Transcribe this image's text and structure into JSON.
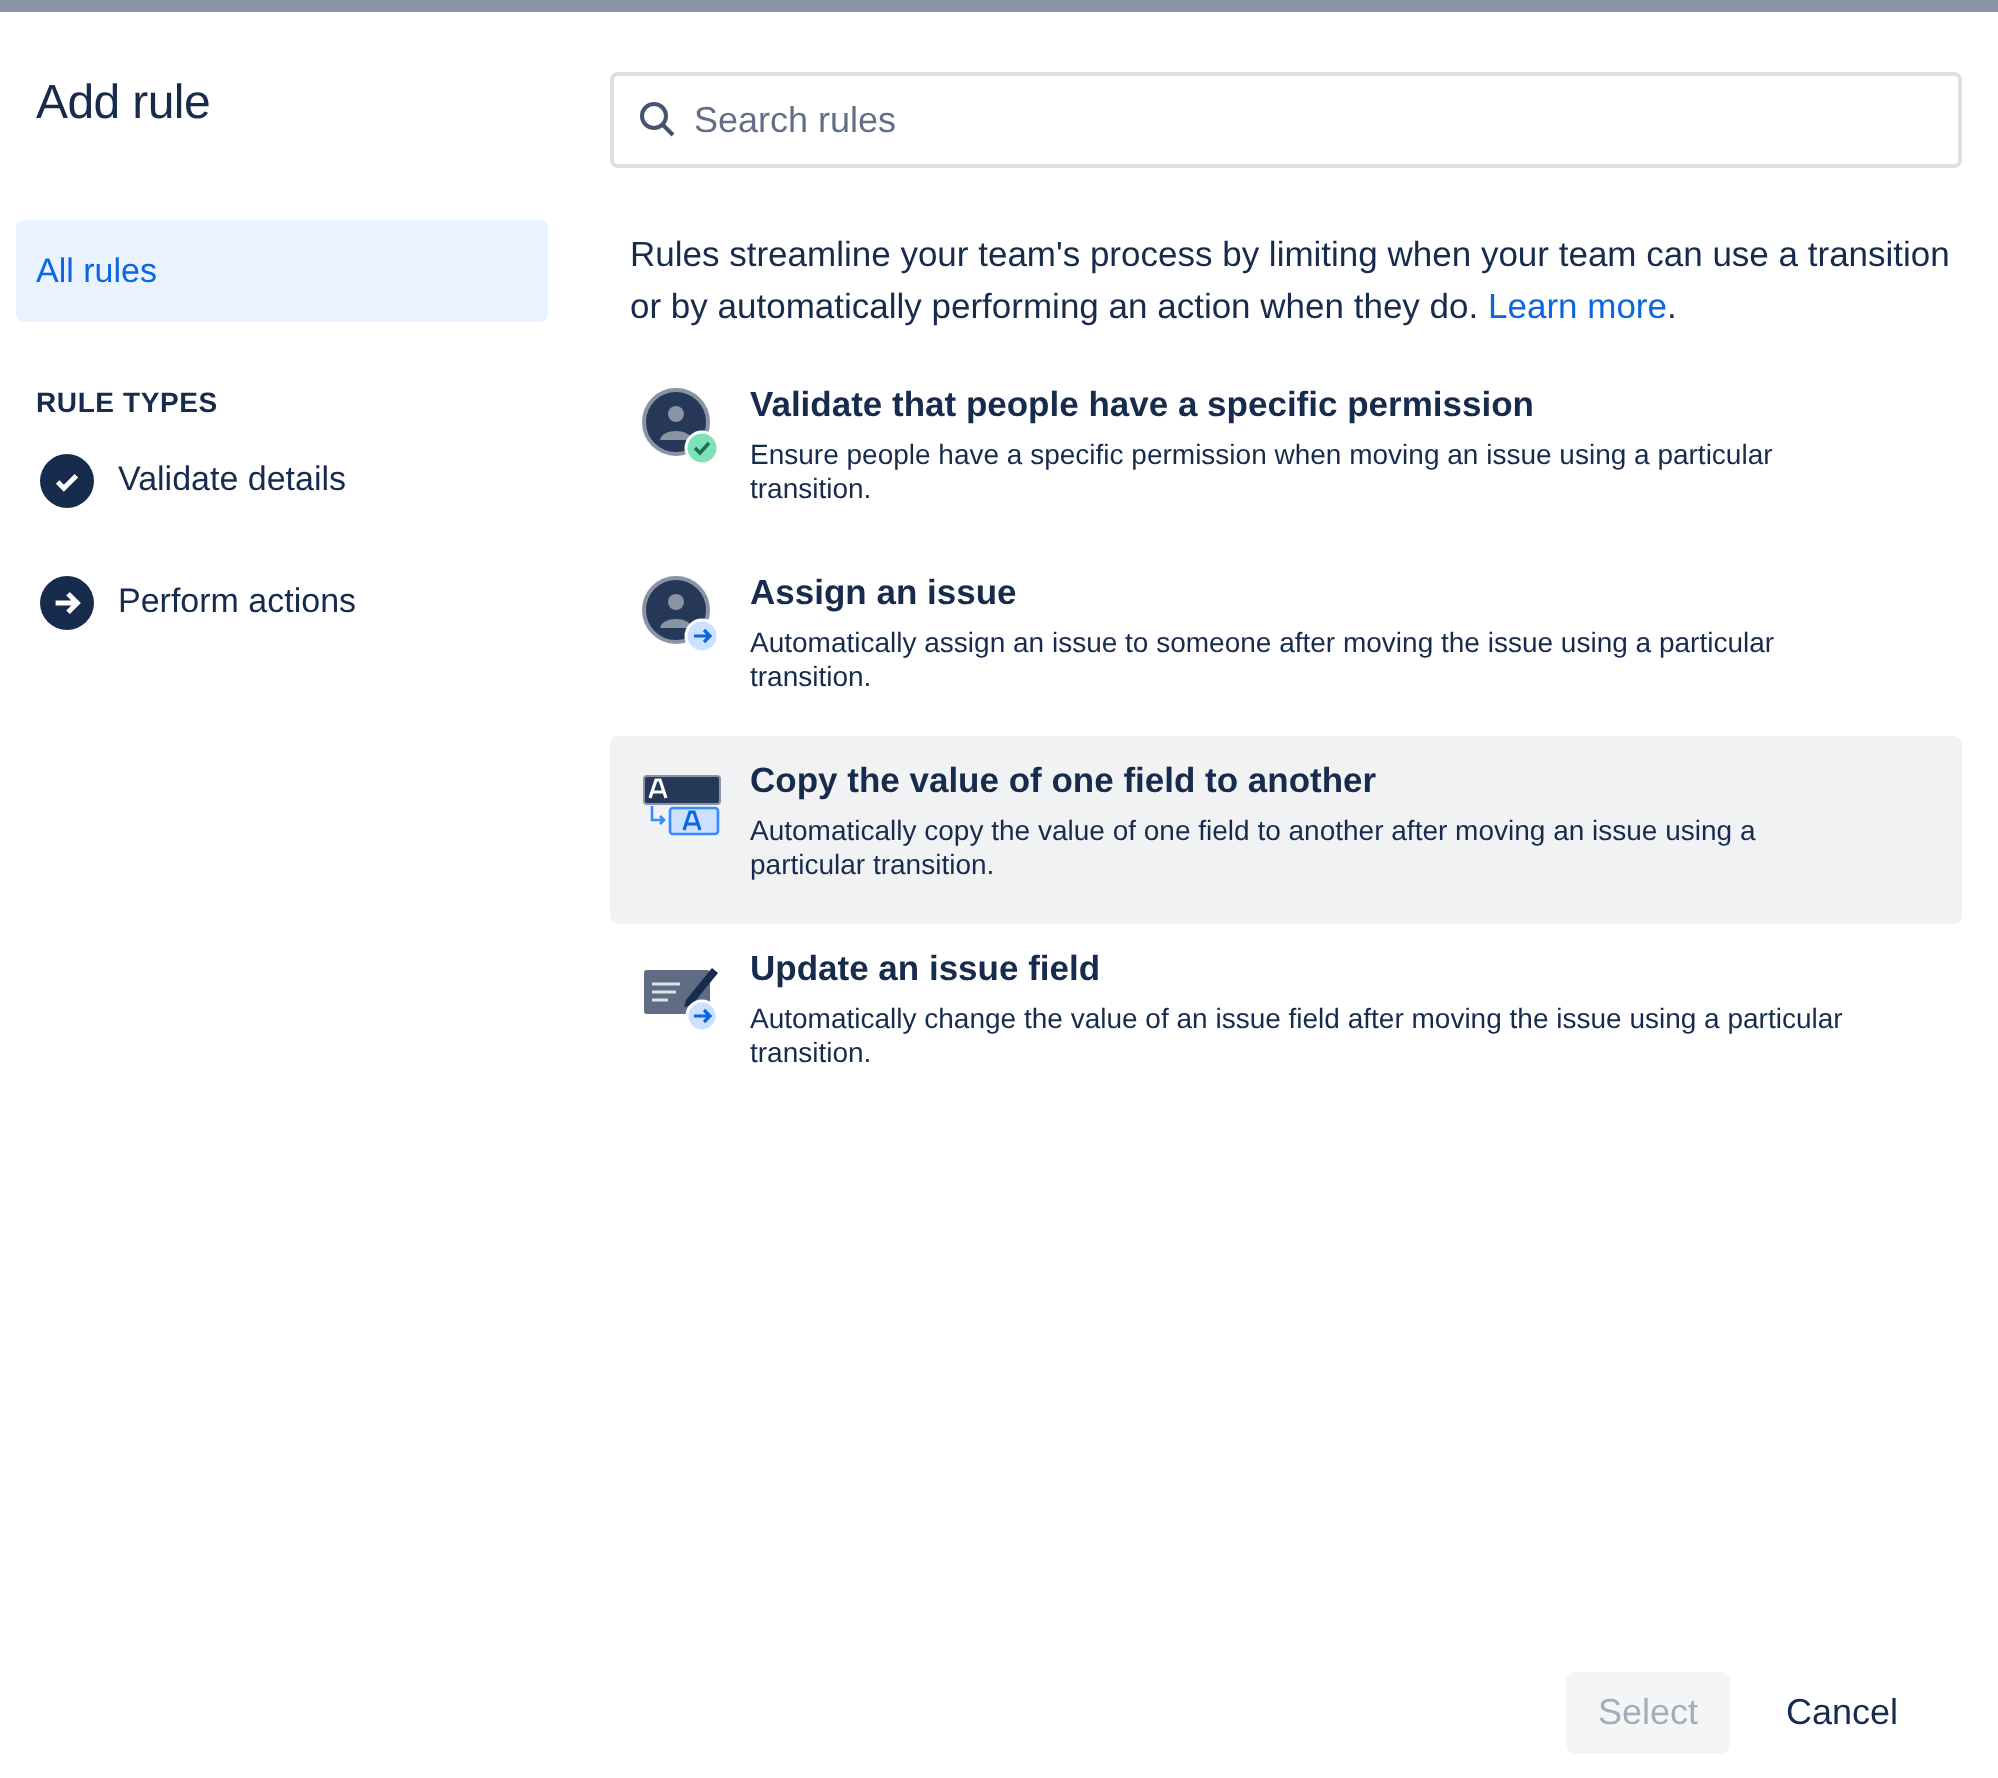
{
  "dialog": {
    "title": "Add rule"
  },
  "sidebar": {
    "items": [
      {
        "label": "All rules",
        "selected": true
      }
    ],
    "section_heading": "RULE TYPES",
    "rule_types": [
      {
        "label": "Validate details",
        "kind": "check",
        "selected": false
      },
      {
        "label": "Perform actions",
        "kind": "arrow",
        "selected": false
      }
    ]
  },
  "search": {
    "placeholder": "Search rules"
  },
  "intro": {
    "text": "Rules streamline your team's process by limiting when your team can use a transition or by automatically performing an action when they do.",
    "link": "Learn more",
    "after": "."
  },
  "rules": [
    {
      "kind": "permission",
      "title": "Validate that people have a specific permission",
      "description": "Ensure people have a specific permission when moving an issue using a particular transition.",
      "highlighted": false
    },
    {
      "kind": "assign",
      "title": "Assign an issue",
      "description": "Automatically assign an issue to someone after moving the issue using a particular transition.",
      "highlighted": false
    },
    {
      "kind": "copy",
      "title": "Copy the value of one field to another",
      "description": "Automatically copy the value of one field to another after moving an issue using a particular transition.",
      "highlighted": true
    },
    {
      "kind": "update",
      "title": "Update an issue field",
      "description": "Automatically change the value of an issue field after moving the issue using a particular transition.",
      "highlighted": false
    }
  ],
  "footer": {
    "buttons": [
      {
        "label": "Select",
        "disabled": true
      },
      {
        "label": "Cancel",
        "disabled": false
      }
    ]
  }
}
